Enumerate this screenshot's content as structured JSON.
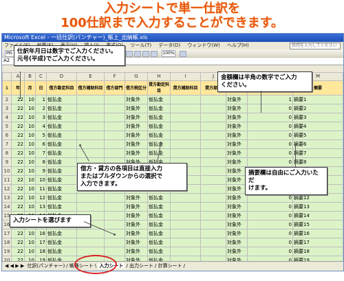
{
  "headline": {
    "line1": "入力シートで単一仕訳を",
    "line2": "100仕訳まで入力することができます。"
  },
  "window": {
    "title": "Microsoft Excel - 一括仕訳(パンチャー)_帳上_出納帳.xls"
  },
  "menu": {
    "items": [
      "ファイル(F)",
      "編集(E)",
      "表示(V)",
      "挿入(I)",
      "書式(O)",
      "ツール(T)",
      "データ(D)",
      "ウィンドウ(W)",
      "ヘルプ(H)"
    ],
    "help_placeholder": "質問を入力してください"
  },
  "toolbar": {
    "font_name": "MS P",
    "zoom": "100%"
  },
  "formula": {
    "name_box": "A2",
    "fx": "fx"
  },
  "sheet": {
    "columns": [
      "",
      "A",
      "B",
      "C",
      "D",
      "E",
      "F",
      "G",
      "H",
      "I",
      "J",
      "K",
      "L",
      "M"
    ],
    "headers": [
      "年",
      "月",
      "日",
      "借方勘定科目",
      "借方補助科目",
      "借方部門",
      "借方税区分",
      "貸方勘定科目",
      "貸方補助科目",
      "貸方部門",
      "貸方税区分",
      "金額",
      "摘要"
    ],
    "rows": [
      {
        "n": "2",
        "y": "22",
        "m": "10",
        "d": "1",
        "dr": "仮払金",
        "tax": "対象外",
        "cr": "仮払金",
        "ctax": "対象外",
        "amt": "1",
        "memo": "摘要1"
      },
      {
        "n": "3",
        "y": "22",
        "m": "10",
        "d": "2",
        "dr": "仮払金",
        "tax": "対象外",
        "cr": "仮払金",
        "ctax": "対象外",
        "amt": "0",
        "memo": "摘要2"
      },
      {
        "n": "4",
        "y": "22",
        "m": "10",
        "d": "3",
        "dr": "仮払金",
        "tax": "対象外",
        "cr": "仮払金",
        "ctax": "対象外",
        "amt": "0",
        "memo": "摘要3"
      },
      {
        "n": "5",
        "y": "22",
        "m": "10",
        "d": "4",
        "dr": "仮払金",
        "tax": "対象外",
        "cr": "仮払金",
        "ctax": "対象外",
        "amt": "0",
        "memo": "摘要4"
      },
      {
        "n": "6",
        "y": "22",
        "m": "10",
        "d": "5",
        "dr": "仮払金",
        "tax": "対象外",
        "cr": "仮払金",
        "ctax": "対象外",
        "amt": "0",
        "memo": "摘要5"
      },
      {
        "n": "7",
        "y": "22",
        "m": "10",
        "d": "6",
        "dr": "仮払金",
        "tax": "対象外",
        "cr": "仮払金",
        "ctax": "対象外",
        "amt": "0",
        "memo": "摘要6"
      },
      {
        "n": "8",
        "y": "22",
        "m": "10",
        "d": "7",
        "dr": "仮払金",
        "tax": "対象外",
        "cr": "仮払金",
        "ctax": "対象外",
        "amt": "0",
        "memo": "摘要7"
      },
      {
        "n": "9",
        "y": "22",
        "m": "10",
        "d": "8",
        "dr": "仮払金",
        "tax": "対象外",
        "cr": "仮払金",
        "ctax": "対象外",
        "amt": "0",
        "memo": "摘要8"
      },
      {
        "n": "10",
        "y": "22",
        "m": "10",
        "d": "9",
        "dr": "仮払金",
        "tax": "対象外",
        "cr": "仮払金",
        "ctax": "対象外",
        "amt": "0",
        "memo": "摘要9"
      },
      {
        "n": "11",
        "y": "22",
        "m": "10",
        "d": "10",
        "dr": "仮払金",
        "tax": "対象外",
        "cr": "仮払金",
        "ctax": "対象外",
        "amt": "0",
        "memo": "摘要10"
      },
      {
        "n": "12",
        "y": "22",
        "m": "10",
        "d": "11",
        "dr": "仮払金",
        "tax": "対象外",
        "cr": "仮払金",
        "ctax": "対象外",
        "amt": "0",
        "memo": "摘要11"
      },
      {
        "n": "13",
        "y": "22",
        "m": "10",
        "d": "12",
        "dr": "仮払金",
        "tax": "対象外",
        "cr": "仮払金",
        "ctax": "対象外",
        "amt": "0",
        "memo": "摘要12"
      },
      {
        "n": "14",
        "y": "22",
        "m": "10",
        "d": "13",
        "dr": "仮払金",
        "tax": "対象外",
        "cr": "仮払金",
        "ctax": "対象外",
        "amt": "0",
        "memo": "摘要13"
      },
      {
        "n": "15",
        "y": "22",
        "m": "10",
        "d": "14",
        "dr": "仮払金",
        "tax": "対象外",
        "cr": "仮払金",
        "ctax": "対象外",
        "amt": "0",
        "memo": "摘要14"
      },
      {
        "n": "16",
        "y": "22",
        "m": "10",
        "d": "15",
        "dr": "仮払金",
        "tax": "対象外",
        "cr": "仮払金",
        "ctax": "対象外",
        "amt": "0",
        "memo": "摘要15"
      },
      {
        "n": "17",
        "y": "22",
        "m": "10",
        "d": "16",
        "dr": "仮払金",
        "tax": "対象外",
        "cr": "仮払金",
        "ctax": "対象外",
        "amt": "0",
        "memo": "摘要16"
      },
      {
        "n": "18",
        "y": "22",
        "m": "10",
        "d": "17",
        "dr": "仮払金",
        "tax": "対象外",
        "cr": "仮払金",
        "ctax": "対象外",
        "amt": "0",
        "memo": "摘要17"
      },
      {
        "n": "19",
        "y": "22",
        "m": "10",
        "d": "18",
        "dr": "仮払金",
        "tax": "対象外",
        "cr": "仮払金",
        "ctax": "対象外",
        "amt": "0",
        "memo": "摘要18"
      },
      {
        "n": "20",
        "y": "22",
        "m": "10",
        "d": "19",
        "dr": "仮払金",
        "tax": "対象外",
        "cr": "仮払金",
        "ctax": "対象外",
        "amt": "0",
        "memo": "摘要19"
      }
    ]
  },
  "tabs": [
    "仕訳(パンチャー)",
    "帳簿シート",
    "入力シート",
    "出力シート",
    "計算シート"
  ],
  "tab_nav": "◀ ◀ ▶ ▶",
  "callouts": {
    "date": "仕訳年月日は数字でご入力ください。\n元号(平成)でご入力ください。",
    "amount": "金額欄は半角の数字でご入力\nください。",
    "account": "借方・貸方の各項目は直接入力\nまたはプルダウンからの選択で\n入力できます。",
    "memo": "摘要欄は自由にご入力いただ\nけます。",
    "sheet": "入力シートを選びます"
  }
}
